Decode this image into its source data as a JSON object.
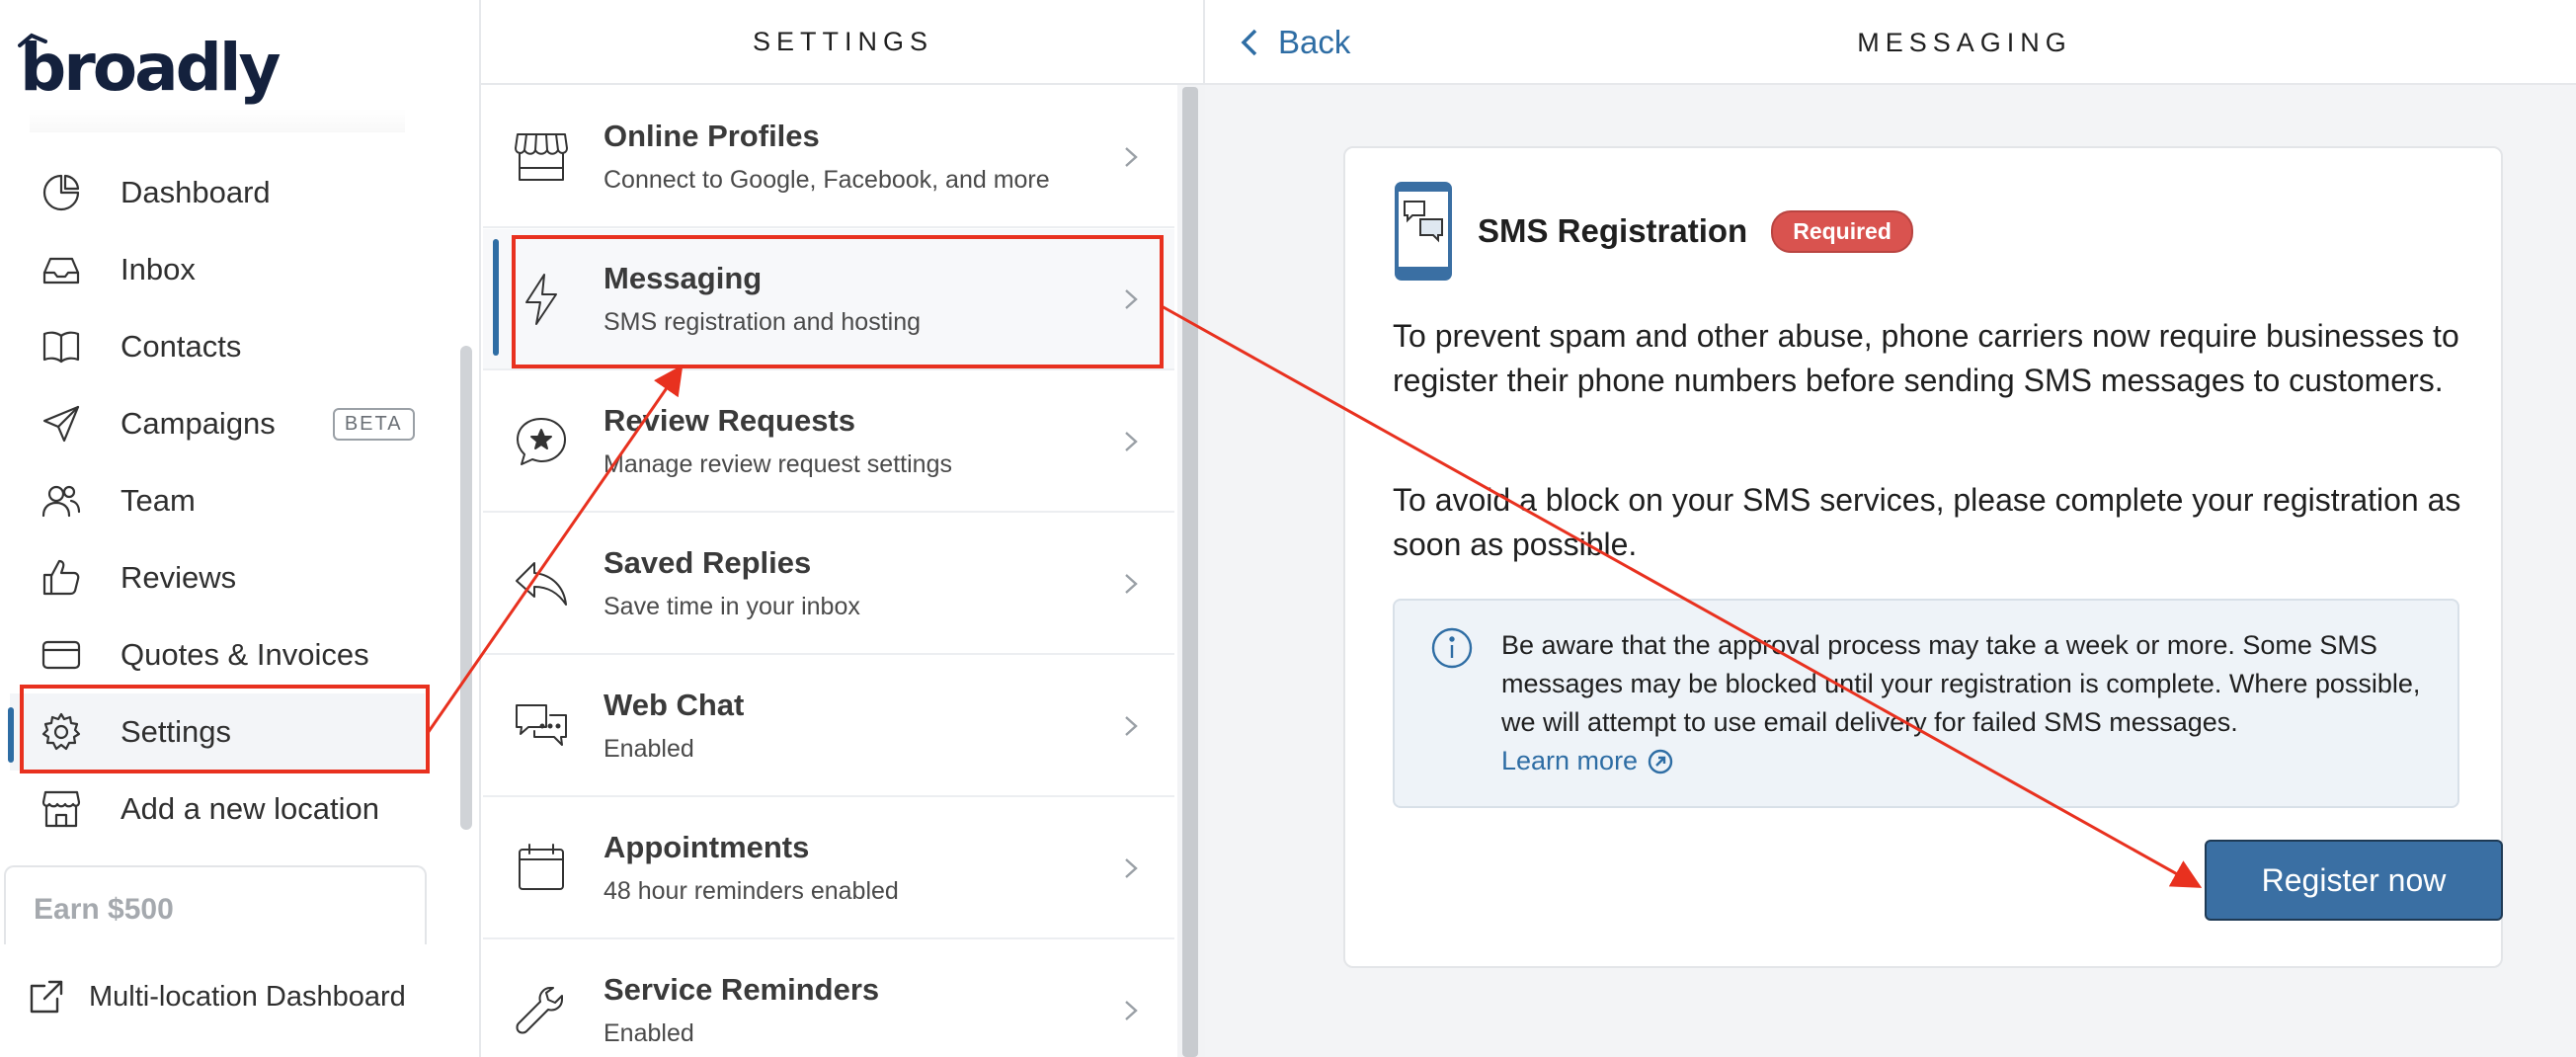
{
  "brand": {
    "logo_text": "broadly"
  },
  "nav": {
    "items": [
      {
        "label": "Dashboard",
        "icon": "pie-chart-icon"
      },
      {
        "label": "Inbox",
        "icon": "inbox-tray-icon"
      },
      {
        "label": "Contacts",
        "icon": "open-book-icon"
      },
      {
        "label": "Campaigns",
        "icon": "paper-plane-icon",
        "badge": "BETA"
      },
      {
        "label": "Team",
        "icon": "people-icon"
      },
      {
        "label": "Reviews",
        "icon": "thumbs-up-icon"
      },
      {
        "label": "Quotes & Invoices",
        "icon": "credit-card-icon"
      },
      {
        "label": "Settings",
        "icon": "gear-icon",
        "active": true
      },
      {
        "label": "Add a new location",
        "icon": "storefront-icon"
      }
    ],
    "earn_card": "Earn $500",
    "multi_location": "Multi-location Dashboard"
  },
  "settings": {
    "header": "SETTINGS",
    "items": [
      {
        "title": "Online Profiles",
        "subtitle": "Connect to Google, Facebook, and more",
        "icon": "storefront-awning-icon"
      },
      {
        "title": "Messaging",
        "subtitle": "SMS registration and hosting",
        "icon": "lightning-bolt-icon",
        "active": true
      },
      {
        "title": "Review Requests",
        "subtitle": "Manage review request settings",
        "icon": "speech-bubble-star-icon"
      },
      {
        "title": "Saved Replies",
        "subtitle": "Save time in your inbox",
        "icon": "reply-arrow-icon"
      },
      {
        "title": "Web Chat",
        "subtitle": "Enabled",
        "icon": "chat-bubbles-icon"
      },
      {
        "title": "Appointments",
        "subtitle": "48 hour reminders enabled",
        "icon": "calendar-icon"
      },
      {
        "title": "Service Reminders",
        "subtitle": "Enabled",
        "icon": "wrench-icon"
      }
    ]
  },
  "messaging": {
    "back_label": "Back",
    "header": "MESSAGING",
    "card": {
      "title": "SMS Registration",
      "badge": "Required",
      "paragraph1": "To prevent spam and other abuse, phone carriers now require businesses to register their phone numbers before sending SMS messages to customers.",
      "paragraph2": "To avoid a block on your SMS services, please complete your registration as soon as possible.",
      "notice": "Be aware that the approval process may take a week or more. Some SMS messages may be blocked until your registration is complete. Where possible, we will attempt to use email delivery for failed SMS messages.",
      "learn_more": "Learn more",
      "register_button": "Register now"
    }
  },
  "colors": {
    "accent": "#2e6da4",
    "required": "#d9534f",
    "annotation": "#e8311f"
  }
}
